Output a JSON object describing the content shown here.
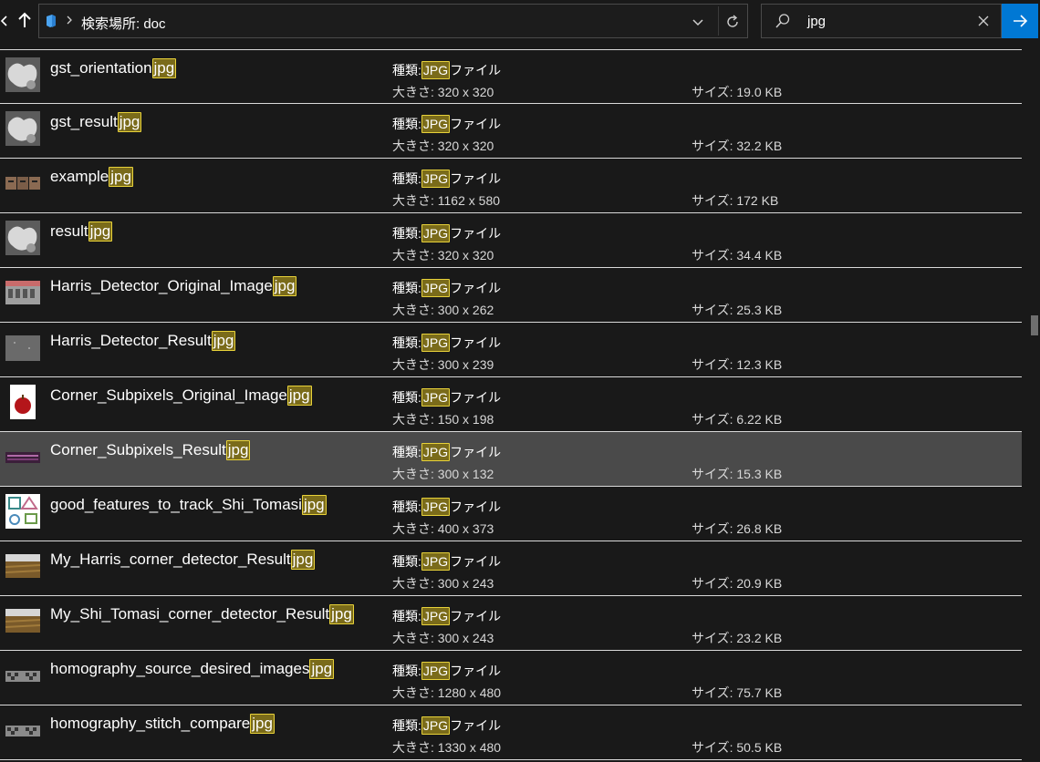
{
  "address": {
    "path_text": "検索場所: doc"
  },
  "search": {
    "query": "jpg"
  },
  "labels": {
    "type_prefix": "種類:",
    "type_highlight": "JPG",
    "type_suffix": "ファイル",
    "dimensions_prefix": "大きさ: ",
    "size_prefix": "サイズ: "
  },
  "highlight_term": "jpg",
  "files": [
    {
      "name": "gst_orientation",
      "ext": "jpg",
      "dimensions": "320 x 320",
      "size": "19.0 KB",
      "thumb": "gray-blob"
    },
    {
      "name": "gst_result",
      "ext": "jpg",
      "dimensions": "320 x 320",
      "size": "32.2 KB",
      "thumb": "gray-blob"
    },
    {
      "name": "example",
      "ext": "jpg",
      "dimensions": "1162 x 580",
      "size": "172 KB",
      "thumb": "faces"
    },
    {
      "name": "result",
      "ext": "jpg",
      "dimensions": "320 x 320",
      "size": "34.4 KB",
      "thumb": "gray-blob"
    },
    {
      "name": "Harris_Detector_Original_Image",
      "ext": "jpg",
      "dimensions": "300 x 262",
      "size": "25.3 KB",
      "thumb": "building"
    },
    {
      "name": "Harris_Detector_Result",
      "ext": "jpg",
      "dimensions": "300 x 239",
      "size": "12.3 KB",
      "thumb": "dark-gray"
    },
    {
      "name": "Corner_Subpixels_Original_Image",
      "ext": "jpg",
      "dimensions": "150 x 198",
      "size": "6.22 KB",
      "thumb": "apple"
    },
    {
      "name": "Corner_Subpixels_Result",
      "ext": "jpg",
      "dimensions": "300 x 132",
      "size": "15.3 KB",
      "thumb": "purple-strip"
    },
    {
      "name": "good_features_to_track_Shi_Tomasi",
      "ext": "jpg",
      "dimensions": "400 x 373",
      "size": "26.8 KB",
      "thumb": "shapes"
    },
    {
      "name": "My_Harris_corner_detector_Result",
      "ext": "jpg",
      "dimensions": "300 x 243",
      "size": "20.9 KB",
      "thumb": "field"
    },
    {
      "name": "My_Shi_Tomasi_corner_detector_Result",
      "ext": "jpg",
      "dimensions": "300 x 243",
      "size": "23.2 KB",
      "thumb": "field"
    },
    {
      "name": "homography_source_desired_images",
      "ext": "jpg",
      "dimensions": "1280 x 480",
      "size": "75.7 KB",
      "thumb": "checker"
    },
    {
      "name": "homography_stitch_compare",
      "ext": "jpg",
      "dimensions": "1330 x 480",
      "size": "50.5 KB",
      "thumb": "checker"
    }
  ],
  "selected_index": 7,
  "colors": {
    "background": "#191919",
    "highlight_border": "#e8d23a",
    "highlight_fill": "#7a6b1a",
    "selection": "#4a4a4a",
    "accent": "#0078d4"
  },
  "icons": {
    "up": "up-arrow-icon",
    "drive": "drive-icon",
    "breadcrumb": "chevron-right-icon",
    "dropdown": "chevron-down-icon",
    "refresh": "refresh-icon",
    "search": "search-icon",
    "clear": "close-icon",
    "go": "arrow-right-icon"
  }
}
